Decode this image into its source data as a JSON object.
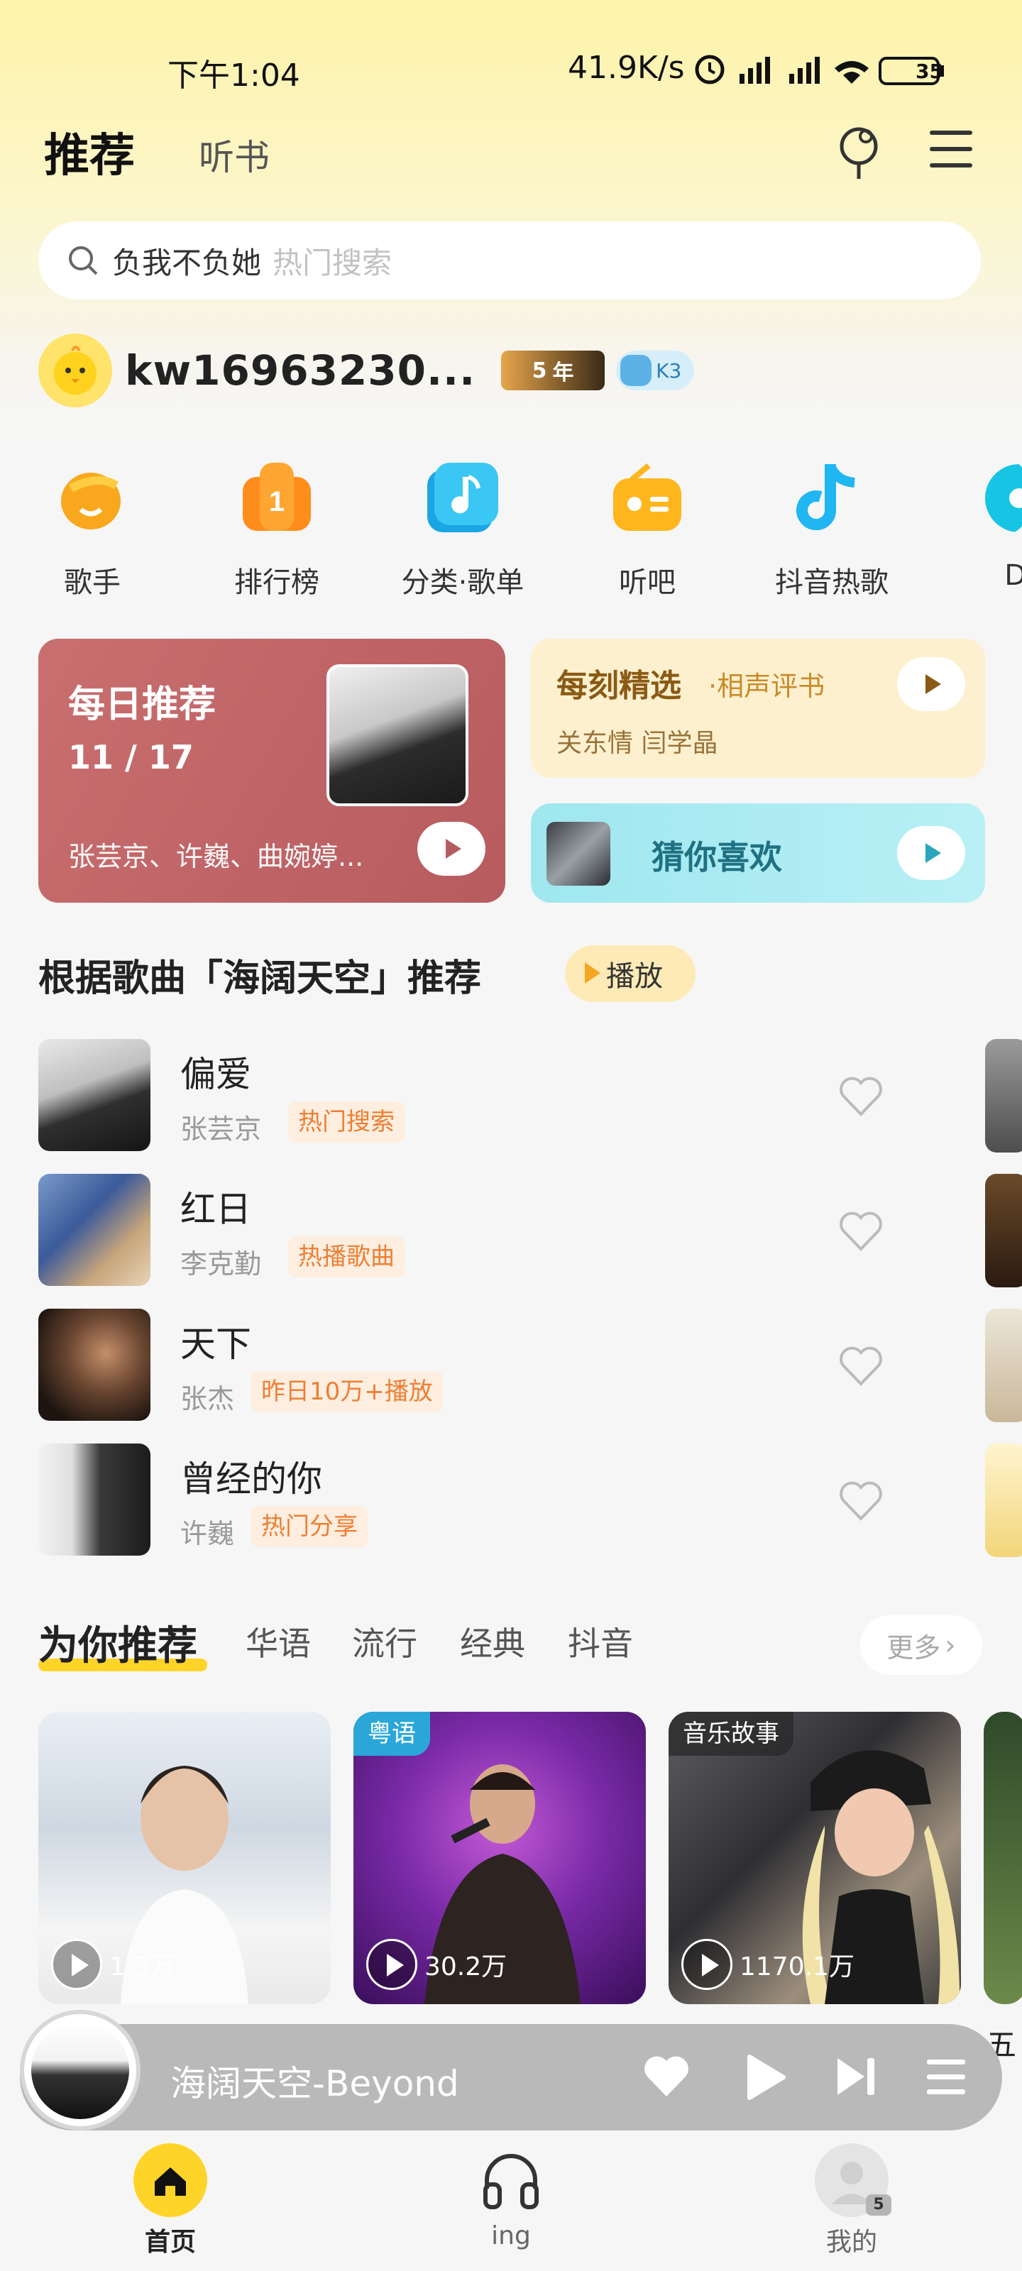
{
  "status_bar": {
    "time": "下午1:04",
    "speed": "41.9K/s",
    "battery": "35"
  },
  "header": {
    "tab_active": "推荐",
    "tab_2": "听书"
  },
  "search": {
    "keyword": "负我不负她",
    "hint": "热门搜索"
  },
  "user": {
    "name": "kw16963230...",
    "vip_years": "5",
    "vip_year_unit": "年",
    "level": "K3"
  },
  "categories": [
    {
      "label": "歌手",
      "icon": "singer-icon",
      "color": "#f7a21b"
    },
    {
      "label": "排行榜",
      "icon": "rank-icon",
      "color": "#ff8a1c"
    },
    {
      "label": "分类·歌单",
      "icon": "playlist-icon",
      "color": "#25b8f0"
    },
    {
      "label": "听吧",
      "icon": "radio-icon",
      "color": "#ffb31a"
    },
    {
      "label": "抖音热歌",
      "icon": "tiktok-icon",
      "color": "#1fb6f2"
    },
    {
      "label": "D",
      "icon": "dj-icon",
      "color": "#1bc6e6"
    }
  ],
  "daily": {
    "title": "每日推荐",
    "date": "11 / 17",
    "subtitle": "张芸京、许巍、曲婉婷..."
  },
  "moment": {
    "title": "每刻精选",
    "tag": "·相声评书",
    "subtitle": "关东情 闫学晶"
  },
  "guess": {
    "title": "猜你喜欢"
  },
  "section": {
    "title": "根据歌曲「海阔天空」推荐",
    "play_label": "播放"
  },
  "songs": [
    {
      "name": "偏爱",
      "artist": "张芸京",
      "tag": "热门搜索"
    },
    {
      "name": "红日",
      "artist": "李克勤",
      "tag": "热播歌曲"
    },
    {
      "name": "天下",
      "artist": "张杰",
      "tag": "昨日10万+播放"
    },
    {
      "name": "曾经的你",
      "artist": "许巍",
      "tag": "热门分享"
    }
  ],
  "recommend": {
    "title": "为你推荐",
    "tabs": [
      "华语",
      "流行",
      "经典",
      "抖音"
    ],
    "more": "更多",
    "cards": [
      {
        "plays": "1.3万",
        "tag": ""
      },
      {
        "plays": "30.2万",
        "tag": "粤语"
      },
      {
        "plays": "1170.1万",
        "tag": "音乐故事"
      }
    ],
    "peek_text": "五"
  },
  "player": {
    "title": "海阔天空-Beyond"
  },
  "nav": {
    "home": "首页",
    "ing": "ing",
    "mine": "我的",
    "mine_badge": "5"
  }
}
